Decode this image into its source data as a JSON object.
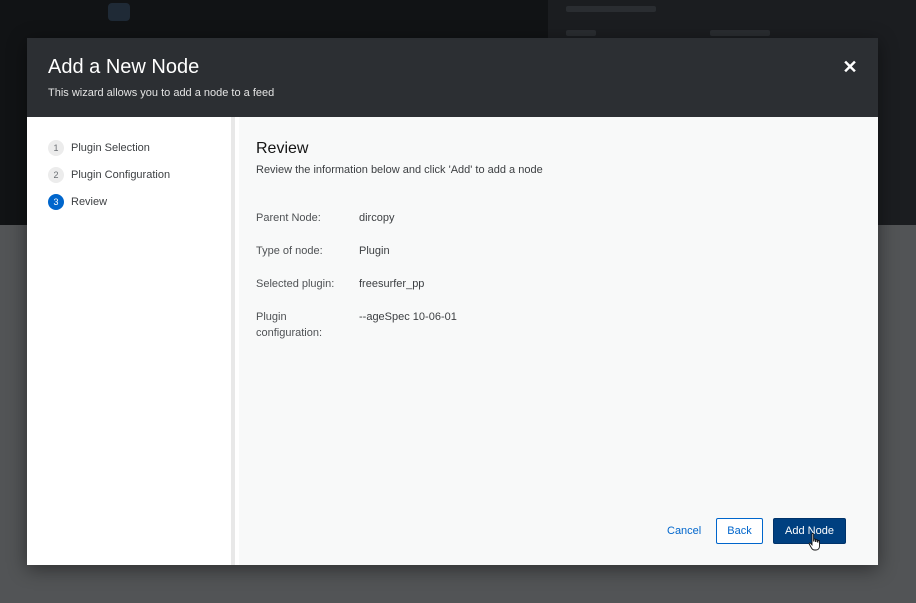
{
  "modal": {
    "title": "Add a New Node",
    "subtitle": "This wizard allows you to add a node to a feed",
    "close_icon": "close-icon"
  },
  "steps": [
    {
      "number": "1",
      "label": "Plugin Selection"
    },
    {
      "number": "2",
      "label": "Plugin Configuration"
    },
    {
      "number": "3",
      "label": "Review"
    }
  ],
  "current_step": 3,
  "review": {
    "title": "Review",
    "description": "Review the information below and click 'Add' to add a node",
    "rows": [
      {
        "label": "Parent Node:",
        "value": "dircopy"
      },
      {
        "label": "Type of node:",
        "value": "Plugin"
      },
      {
        "label": "Selected plugin:",
        "value": "freesurfer_pp"
      },
      {
        "label": "Plugin configuration:",
        "value": "--ageSpec 10-06-01"
      }
    ]
  },
  "footer": {
    "cancel_label": "Cancel",
    "back_label": "Back",
    "add_label": "Add Node"
  },
  "colors": {
    "accent": "#0066cc",
    "primary_button": "#004080",
    "header_bg": "#2c2f33"
  }
}
